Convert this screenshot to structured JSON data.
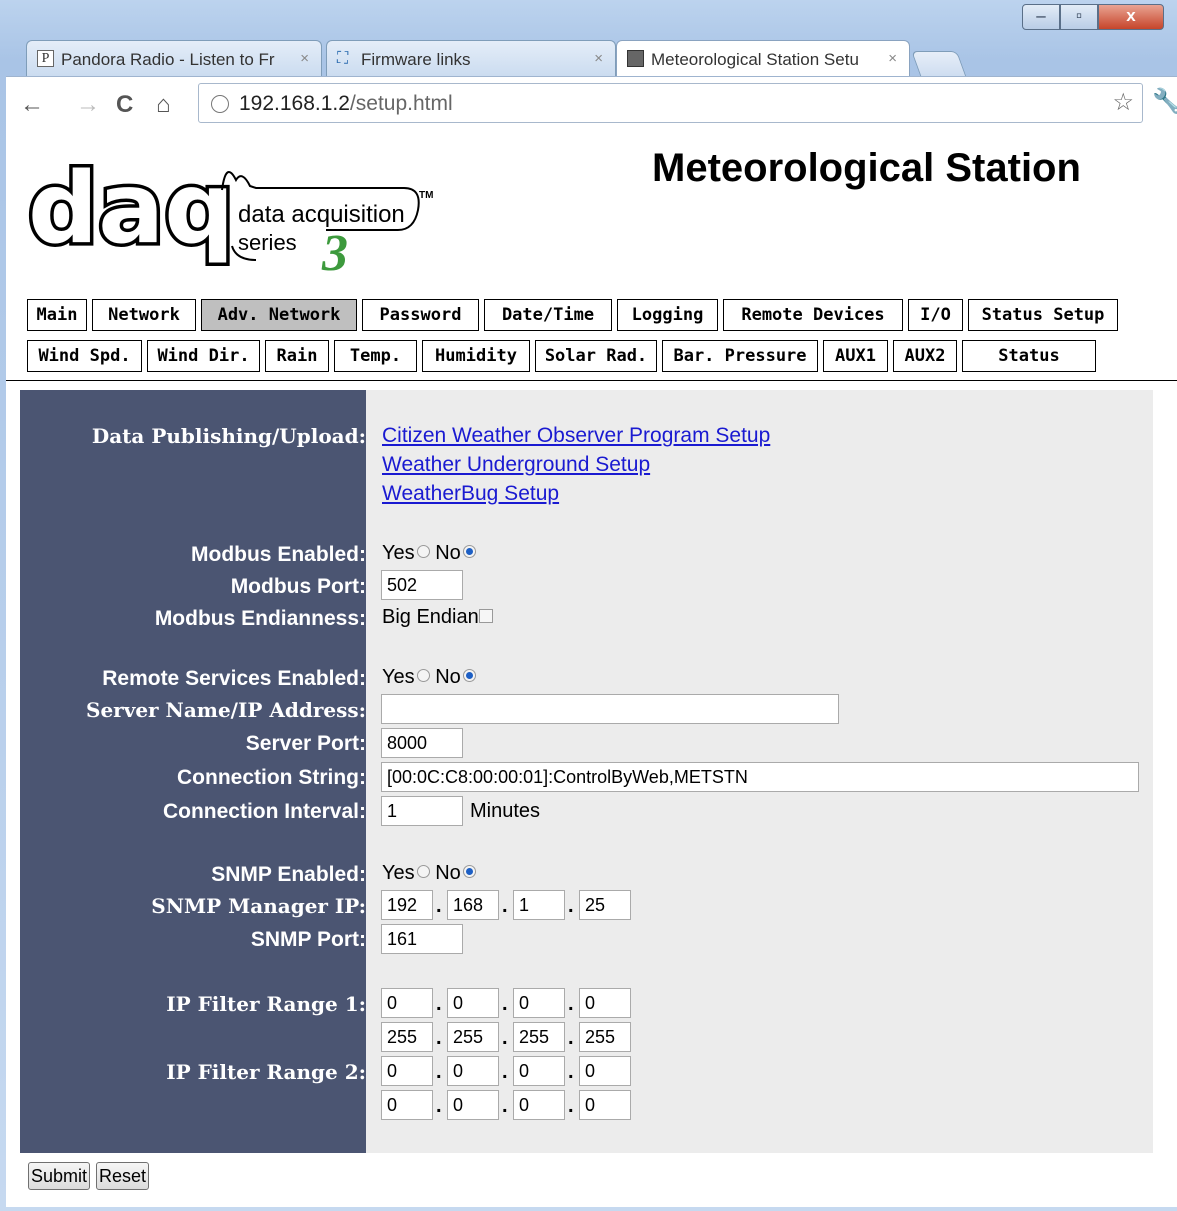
{
  "browser": {
    "tabs": [
      {
        "title": "Pandora Radio - Listen to Fr",
        "icon": "pandora-icon"
      },
      {
        "title": "Firmware links",
        "icon": "bookmark-icon"
      },
      {
        "title": "Meteorological Station Setu",
        "icon": "page-icon",
        "active": true
      }
    ],
    "url_host": "192.168.1.2",
    "url_path": "/setup.html"
  },
  "page": {
    "title": "Meteorological Station",
    "logo": {
      "brand": "daq",
      "tagline1": "data acquisition",
      "tagline2": "series",
      "tm": "TM",
      "series_number": "3"
    },
    "nav_row1": [
      "Main",
      "Network",
      "Adv. Network",
      "Password",
      "Date/Time",
      "Logging",
      "Remote Devices",
      "I/O",
      "Status Setup"
    ],
    "nav_row2": [
      "Wind Spd.",
      "Wind Dir.",
      "Rain",
      "Temp.",
      "Humidity",
      "Solar Rad.",
      "Bar. Pressure",
      "AUX1",
      "AUX2",
      "Status"
    ],
    "selected_tab": "Adv. Network"
  },
  "form": {
    "data_publishing_label": "Data Publishing/Upload:",
    "links": [
      "Citizen Weather Observer Program Setup",
      "Weather Underground Setup",
      "WeatherBug Setup"
    ],
    "modbus_enabled_label": "Modbus Enabled:",
    "modbus_port_label": "Modbus Port:",
    "modbus_port": "502",
    "modbus_endianness_label": "Modbus Endianness:",
    "big_endian_label": "Big Endian",
    "remote_services_label": "Remote Services Enabled:",
    "server_name_label": "Server Name/IP Address:",
    "server_name": "",
    "server_port_label": "Server Port:",
    "server_port": "8000",
    "connection_string_label": "Connection String:",
    "connection_string": "[00:0C:C8:00:00:01]:ControlByWeb,METSTN",
    "connection_interval_label": "Connection Interval:",
    "connection_interval": "1",
    "minutes_label": "Minutes",
    "snmp_enabled_label": "SNMP Enabled:",
    "snmp_manager_label": "SNMP Manager IP:",
    "snmp_manager_ip": [
      "192",
      "168",
      "1",
      "25"
    ],
    "snmp_port_label": "SNMP Port:",
    "snmp_port": "161",
    "ip_filter1_label": "IP Filter Range 1:",
    "ip_filter1_start": [
      "0",
      "0",
      "0",
      "0"
    ],
    "ip_filter1_end": [
      "255",
      "255",
      "255",
      "255"
    ],
    "ip_filter2_label": "IP Filter Range 2:",
    "ip_filter2_start": [
      "0",
      "0",
      "0",
      "0"
    ],
    "ip_filter2_end": [
      "0",
      "0",
      "0",
      "0"
    ],
    "yes_label": "Yes",
    "no_label": "No",
    "submit_label": "Submit",
    "reset_label": "Reset"
  }
}
